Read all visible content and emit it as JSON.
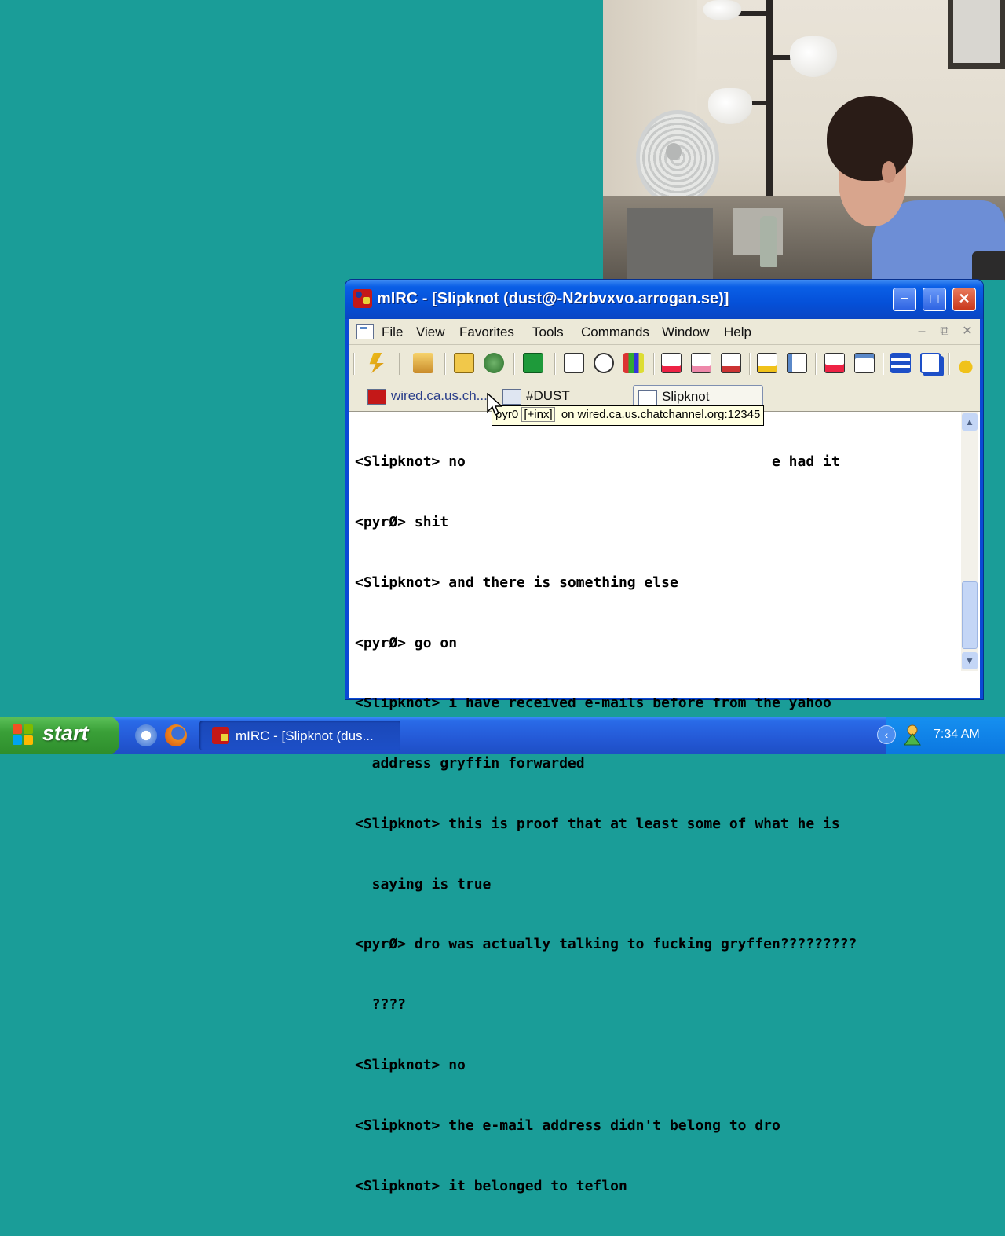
{
  "window": {
    "title": "mIRC - [Slipknot (dust@-N2rbvxvo.arrogan.se)]",
    "controls": {
      "minimize": "−",
      "maximize": "□",
      "close": "✕"
    }
  },
  "menu": {
    "items": [
      "File",
      "View",
      "Favorites",
      "Tools",
      "Commands",
      "Window",
      "Help"
    ],
    "mdi_controls": {
      "minimize": "–",
      "restore": "⧉",
      "close": "✕"
    }
  },
  "toolbar": {
    "icons": [
      "connect-icon",
      "options-icon",
      "channels-folder-icon",
      "address-book-icon",
      "scripts-editor-icon",
      "remote-icon",
      "timer-icon",
      "colors-icon",
      "dcc-send-icon",
      "dcc-chat-icon",
      "dcc-options-icon",
      "received-files-icon",
      "logs-icon",
      "notify-icon",
      "url-list-icon",
      "tile-icon",
      "cascade-icon",
      "about-icon"
    ]
  },
  "switchbar": {
    "tabs": [
      {
        "label": "wired.ca.us.ch...",
        "active": false
      },
      {
        "label": "#DUST",
        "active": false
      },
      {
        "label": "Slipknot",
        "active": true
      }
    ]
  },
  "tooltip": {
    "nick": "pyr0",
    "modes": "[+inx]",
    "server": "on wired.ca.us.chatchannel.org:12345"
  },
  "chat": {
    "lines": [
      "<Slipknot> no                                    e had it",
      "<pyrØ> shit",
      "<Slipknot> and there is something else",
      "<pyrØ> go on",
      "<Slipknot> i have received e-mails before from the yahoo",
      "  address gryffin forwarded",
      "<Slipknot> this is proof that at least some of what he is",
      "  saying is true",
      "<pyrØ> dro was actually talking to fucking gryffen?????????",
      "  ????",
      "<Slipknot> no",
      "<Slipknot> the e-mail address didn't belong to dro",
      "<Slipknot> it belonged to teflon"
    ],
    "input_value": ""
  },
  "taskbar": {
    "start_label": "start",
    "quick_launch": [
      "show-desktop-icon",
      "firefox-icon"
    ],
    "tasks": [
      {
        "label": "mIRC - [Slipknot (dus...",
        "active": true
      }
    ],
    "tray": {
      "expand": "‹",
      "clock": "7:34 AM"
    }
  },
  "colors": {
    "desktop": "#1a9d98",
    "titlebar": "#0550d8",
    "taskbar": "#2459d6",
    "start_button": "#3aa038",
    "tooltip_bg": "#ffffe1"
  }
}
